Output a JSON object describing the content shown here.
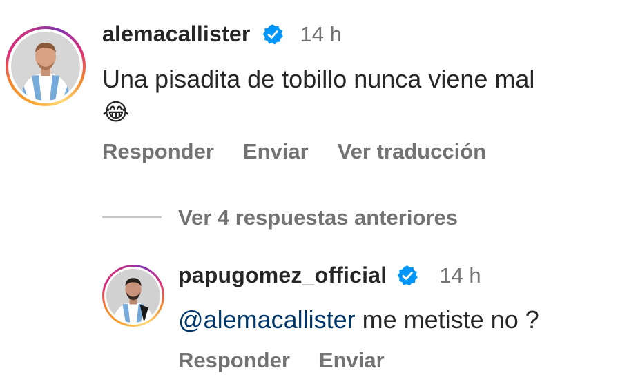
{
  "comment": {
    "username": "alemacallister",
    "time": "14 h",
    "text": "Una pisadita de tobillo nunca viene mal",
    "emoji": "😂",
    "actions": {
      "reply": "Responder",
      "send": "Enviar",
      "translate": "Ver traducción"
    }
  },
  "replies_toggle": "Ver 4 respuestas anteriores",
  "reply": {
    "username": "papugomez_official",
    "time": "14 h",
    "mention": "@alemacallister",
    "text": " me metiste no ?",
    "actions": {
      "reply": "Responder",
      "send": "Enviar"
    }
  },
  "colors": {
    "verified": "#0095f6",
    "mention": "#00376b",
    "secondary_text": "#737373",
    "primary_text": "#262626"
  }
}
